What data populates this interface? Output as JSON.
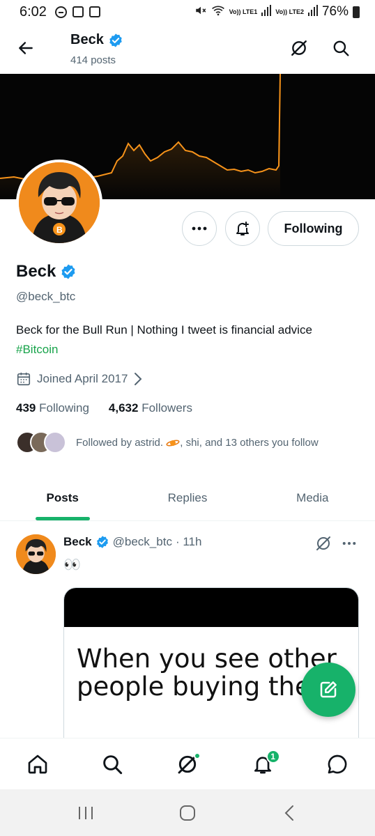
{
  "status_bar": {
    "time": "6:02",
    "battery": "76%",
    "net1": "Vo)) LTE1",
    "net2": "Vo)) LTE2"
  },
  "header": {
    "title": "Beck",
    "subtitle": "414 posts"
  },
  "profile": {
    "name": "Beck",
    "handle": "@beck_btc",
    "bio": "Beck for the Bull Run | Nothing I tweet is financial advice",
    "hashtag": "#Bitcoin",
    "joined": "Joined April 2017",
    "following_count": "439",
    "following_label": "Following",
    "followers_count": "4,632",
    "followers_label": "Followers",
    "followed_by_prefix": "Followed by astrid.",
    "followed_by_suffix": ", shi, and 13 others you follow",
    "follow_button": "Following"
  },
  "tabs": [
    {
      "label": "Posts",
      "active": true
    },
    {
      "label": "Replies",
      "active": false
    },
    {
      "label": "Media",
      "active": false
    }
  ],
  "post": {
    "author": "Beck",
    "handle": "@beck_btc",
    "time": "· 11h",
    "text": "👀",
    "image_text_line1": "When you see other",
    "image_text_line2": "people buying the"
  },
  "bottom_nav": {
    "notifications_badge": "1"
  },
  "colors": {
    "accent": "#17b26a",
    "verified": "#1d9bf0",
    "avatar_bg": "#f08a1c",
    "banner_bg": "#050505",
    "chart_line": "#f7931a"
  }
}
